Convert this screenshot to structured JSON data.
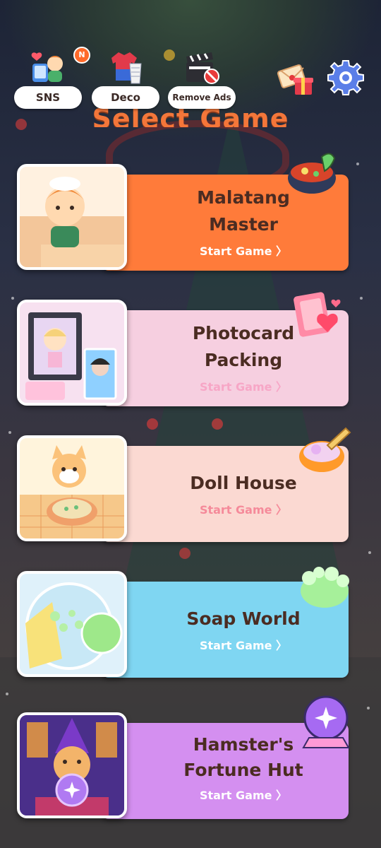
{
  "topbar": {
    "sns_label": "SNS",
    "sns_badge": "N",
    "deco_label": "Deco",
    "remove_ads_label": "Remove Ads"
  },
  "heading": "Select Game",
  "games": [
    {
      "title_line1": "Malatang",
      "title_line2": "Master",
      "start_label": "Start Game 〉",
      "color": "#ff7b3a"
    },
    {
      "title_line1": "Photocard",
      "title_line2": "Packing",
      "start_label": "Start Game 〉",
      "color": "#f6cfe0"
    },
    {
      "title_line1": "Doll House",
      "title_line2": "",
      "start_label": "Start Game 〉",
      "color": "#fbd9d2"
    },
    {
      "title_line1": "Soap World",
      "title_line2": "",
      "start_label": "Start Game 〉",
      "color": "#7fd6f2"
    },
    {
      "title_line1": "Hamster's",
      "title_line2": "Fortune Hut",
      "start_label": "Start Game 〉",
      "color": "#d48ff0"
    }
  ],
  "icons": {
    "sns": "sns-phone-icon",
    "deco": "deco-shirt-icon",
    "remove_ads": "clapperboard-icon",
    "gift": "gift-letter-icon",
    "settings": "gear-icon"
  }
}
